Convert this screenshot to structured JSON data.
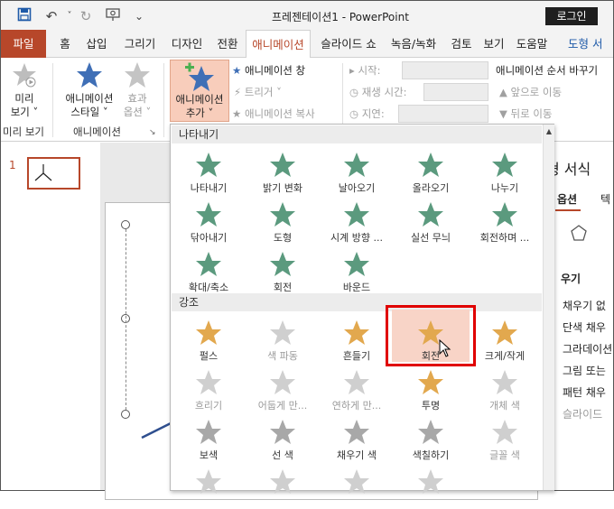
{
  "window": {
    "title": "프레젠테이션1 - PowerPoint",
    "login_label": "로그인"
  },
  "tabs": [
    "파일",
    "홈",
    "삽입",
    "그리기",
    "디자인",
    "전환",
    "애니메이션",
    "슬라이드 쇼",
    "녹음/녹화",
    "검토",
    "보기",
    "도움말",
    "도형 서"
  ],
  "ribbon": {
    "preview_label": "미리\n보기 ˅",
    "preview_group": "미리 보기",
    "anim_style_label": "애니메이션\n스타일 ˅",
    "effect_options_label": "효과\n옵션 ˅",
    "animation_group": "애니메이션",
    "add_animation_label": "애니메이션\n추가 ˅",
    "anim_pane": "애니메이션 창",
    "trigger": "트리거 ˅",
    "anim_copy": "애니메이션 복사",
    "start": "시작:",
    "duration": "재생 시간:",
    "delay": "지연:",
    "reorder_title": "애니메이션 순서 바꾸기",
    "move_earlier": "앞으로 이동",
    "move_later": "뒤로 이동"
  },
  "slides": {
    "number": "1"
  },
  "right_pane": {
    "title": "형 서식",
    "tab_options": "옵션",
    "tab_text": "텍",
    "fill_header": "우기",
    "items": [
      "채우기 없",
      "단색 채우",
      "그라데이션",
      "그림 또는",
      "패턴 채우",
      "슬라이드"
    ]
  },
  "dropdown": {
    "entrance_header": "나타내기",
    "entrance": [
      "나타내기",
      "밝기 변화",
      "날아오기",
      "올라오기",
      "나누기",
      "닦아내기",
      "도형",
      "시계 방향 ...",
      "실선 무늬",
      "회전하며 ...",
      "확대/축소",
      "회전",
      "바운드"
    ],
    "emphasis_header": "강조",
    "emphasis": [
      "펄스",
      "색 파동",
      "흔들기",
      "회전",
      "크게/작게",
      "흐리기",
      "어둡게 만...",
      "연하게 만...",
      "투명",
      "개체 색",
      "보색",
      "선 색",
      "채우기 색",
      "색칠하기",
      "글꼴 색",
      "",
      "",
      "",
      ""
    ],
    "highlighted_item": "회전"
  },
  "colors": {
    "accent": "#b7472a",
    "entrance_star": "#5b9a7e",
    "emphasis_star": "#e2a84e",
    "highlight_border": "#e00000"
  }
}
